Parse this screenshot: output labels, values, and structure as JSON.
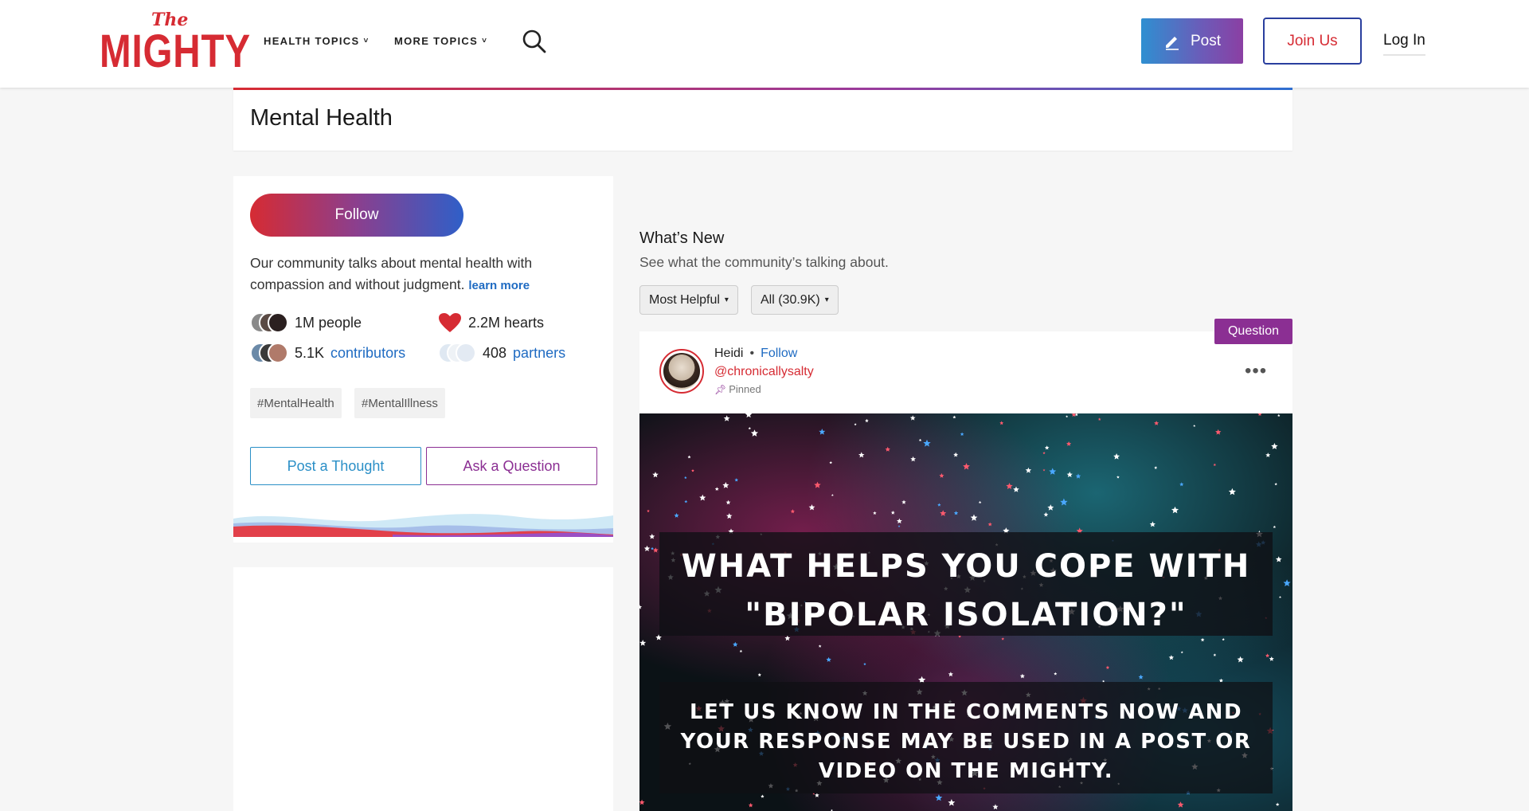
{
  "header": {
    "logo_top": "The",
    "logo_main": "MIGHTY",
    "nav": [
      {
        "label": "HEALTH TOPICS",
        "chevron": "˅"
      },
      {
        "label": "MORE TOPICS",
        "chevron": "˅"
      }
    ],
    "post_label": "Post",
    "join_label": "Join Us",
    "login_label": "Log In"
  },
  "page_title": "Mental Health",
  "community": {
    "follow_label": "Follow",
    "about_text": "Our community talks about mental health with compassion and without judgment.",
    "learn_more": "learn more",
    "people": "1M people",
    "hearts": "2.2M hearts",
    "contributors_count": "5.1K",
    "contributors_label": "contributors",
    "partners_count": "408",
    "partners_label": "partners",
    "tags": [
      "#MentalHealth",
      "#MentalIllness"
    ],
    "post_thought_label": "Post a Thought",
    "ask_question_label": "Ask a Question"
  },
  "feed": {
    "title": "What’s New",
    "subtitle": "See what the community’s talking about.",
    "sort_label": "Most Helpful",
    "filter_label": "All (30.9K)",
    "caret": "▾"
  },
  "post": {
    "badge": "Question",
    "author": "Heidi",
    "separator": "•",
    "follow_label": "Follow",
    "handle": "@chronicallysalty",
    "pinned_label": "Pinned",
    "more_label": "•••",
    "image_headline": "WHAT HELPS YOU COPE WITH \"BIPOLAR ISOLATION?\"",
    "image_subtext": "LET US KNOW IN THE COMMENTS NOW AND YOUR RESPONSE MAY BE USED IN A POST OR VIDEO ON THE MIGHTY."
  },
  "colors": {
    "brand_red": "#d62b33",
    "link_blue": "#1f6bc2",
    "question_purple": "#8b2f93",
    "thought_blue": "#2a8fc7"
  },
  "icons": [
    "search-icon",
    "pencil-icon",
    "heart-icon",
    "pin-icon",
    "more-icon",
    "chevron-down-icon"
  ]
}
